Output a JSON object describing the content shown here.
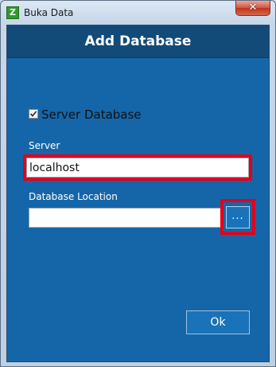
{
  "window": {
    "app_icon_letter": "Z",
    "title": "Buka Data",
    "close_glyph": "✕"
  },
  "dialog": {
    "heading": "Add Database",
    "server_database_checkbox": {
      "label": "Server Database",
      "checked": true
    },
    "server": {
      "label": "Server",
      "value": "localhost"
    },
    "database_location": {
      "label": "Database Location",
      "value": "",
      "browse_label": "..."
    },
    "ok_label": "Ok"
  },
  "colors": {
    "dialog_background": "#1566a8",
    "header_background": "#124a78",
    "highlight_frame": "#e3001b",
    "button_background": "#1a73b8"
  }
}
